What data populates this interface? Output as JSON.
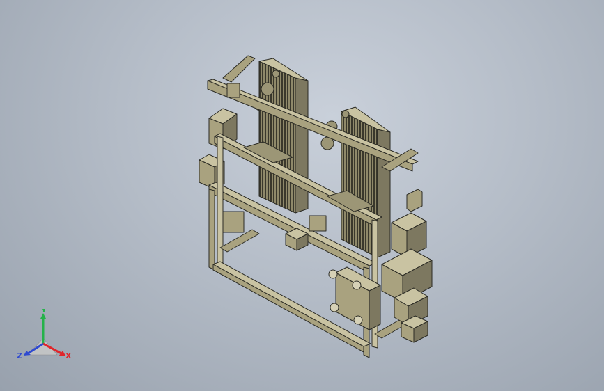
{
  "viewport": {
    "background_top": "#c9d0da",
    "background_bottom": "#98a1ad",
    "model_fill": "#a9a27f",
    "model_dark": "#6b6750",
    "model_light": "#c9c3a2",
    "edge_color": "#2a2a24"
  },
  "triad": {
    "x_label": "X",
    "y_label": "Y",
    "z_label": "Z",
    "x_color": "#e0262b",
    "y_color": "#25b24a",
    "z_color": "#2f4ad0"
  }
}
